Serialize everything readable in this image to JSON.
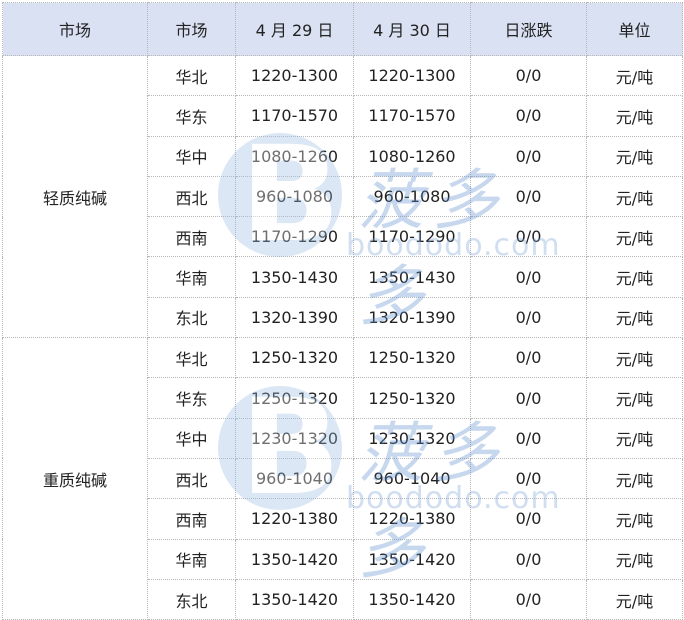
{
  "headers": [
    "市场",
    "市场",
    "4 月 29 日",
    "4 月 30 日",
    "日涨跌",
    "单位"
  ],
  "groups": [
    {
      "name": "轻质纯碱",
      "rows": [
        {
          "market": "华北",
          "apr29": "1220-1300",
          "apr30": "1220-1300",
          "change": "0/0",
          "unit": "元/吨"
        },
        {
          "market": "华东",
          "apr29": "1170-1570",
          "apr30": "1170-1570",
          "change": "0/0",
          "unit": "元/吨"
        },
        {
          "market": "华中",
          "apr29": "1080-1260",
          "apr30": "1080-1260",
          "change": "0/0",
          "unit": "元/吨"
        },
        {
          "market": "西北",
          "apr29": "960-1080",
          "apr30": "960-1080",
          "change": "0/0",
          "unit": "元/吨"
        },
        {
          "market": "西南",
          "apr29": "1170-1290",
          "apr30": "1170-1290",
          "change": "0/0",
          "unit": "元/吨"
        },
        {
          "market": "华南",
          "apr29": "1350-1430",
          "apr30": "1350-1430",
          "change": "0/0",
          "unit": "元/吨"
        },
        {
          "market": "东北",
          "apr29": "1320-1390",
          "apr30": "1320-1390",
          "change": "0/0",
          "unit": "元/吨"
        }
      ]
    },
    {
      "name": "重质纯碱",
      "rows": [
        {
          "market": "华北",
          "apr29": "1250-1320",
          "apr30": "1250-1320",
          "change": "0/0",
          "unit": "元/吨"
        },
        {
          "market": "华东",
          "apr29": "1250-1320",
          "apr30": "1250-1320",
          "change": "0/0",
          "unit": "元/吨"
        },
        {
          "market": "华中",
          "apr29": "1230-1320",
          "apr30": "1230-1320",
          "change": "0/0",
          "unit": "元/吨"
        },
        {
          "market": "西北",
          "apr29": "960-1040",
          "apr30": "960-1040",
          "change": "0/0",
          "unit": "元/吨"
        },
        {
          "market": "西南",
          "apr29": "1220-1380",
          "apr30": "1220-1380",
          "change": "0/0",
          "unit": "元/吨"
        },
        {
          "market": "华南",
          "apr29": "1350-1420",
          "apr30": "1350-1420",
          "change": "0/0",
          "unit": "元/吨"
        },
        {
          "market": "东北",
          "apr29": "1350-1420",
          "apr30": "1350-1420",
          "change": "0/0",
          "unit": "元/吨"
        }
      ]
    }
  ],
  "watermark": {
    "logo_letter": "B",
    "text_cn": "菠多多",
    "url": "boododo.com"
  },
  "colors": {
    "header_bg": "#d9e1f2",
    "grid": "#b8b8b8",
    "watermark": "#5d8fcf"
  }
}
